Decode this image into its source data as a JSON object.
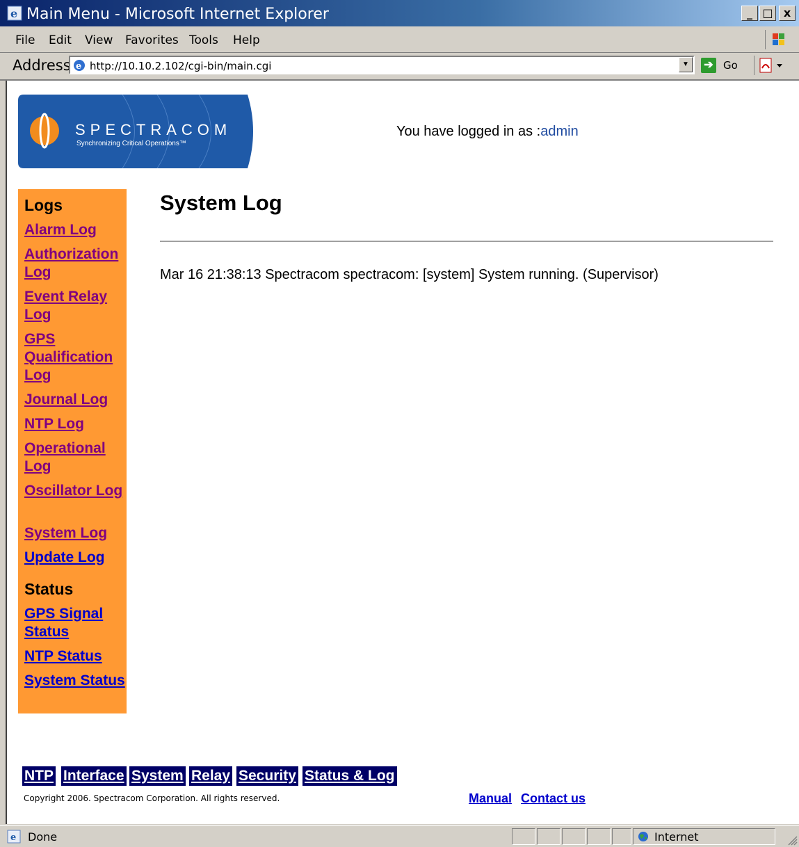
{
  "window": {
    "title": "Main Menu - Microsoft Internet Explorer",
    "min_label": "_",
    "max_label": "□",
    "close_label": "x"
  },
  "menu": [
    "File",
    "Edit",
    "View",
    "Favorites",
    "Tools",
    "Help"
  ],
  "address": {
    "label": "Address",
    "url": "http://10.10.2.102/cgi-bin/main.cgi",
    "go_label": "Go"
  },
  "header": {
    "logo_text": "SPECTRACOM",
    "logo_tagline": "Synchronizing Critical Operations™",
    "logged_prefix": "You have logged in as :",
    "username": "admin"
  },
  "sidebar": {
    "logs_heading": "Logs",
    "logs": [
      "Alarm Log",
      "Authorization Log",
      "Event Relay Log",
      "GPS Qualification Log",
      "Journal Log",
      "NTP Log",
      "Operational Log",
      "Oscillator Log",
      "System Log",
      "Update Log"
    ],
    "status_heading": "Status",
    "status": [
      "GPS Signal Status",
      "NTP Status",
      "System Status"
    ]
  },
  "main": {
    "title": "System Log",
    "entries": [
      "Mar 16 21:38:13 Spectracom spectracom: [system] System running. (Supervisor)"
    ]
  },
  "navbar": [
    "NTP",
    "Interface",
    "System",
    "Relay",
    "Security",
    "Status & Log"
  ],
  "footer": {
    "copyright": "Copyright 2006. Spectracom Corporation. All rights reserved.",
    "manual": "Manual",
    "contact": "Contact us"
  },
  "status": {
    "text": "Done",
    "zone": "Internet"
  },
  "colors": {
    "sidebar_bg": "#ff9933",
    "nav_bg": "#000066",
    "logo_blue": "#1f5aa8",
    "visited_link": "#800080",
    "link": "#0000cc"
  }
}
